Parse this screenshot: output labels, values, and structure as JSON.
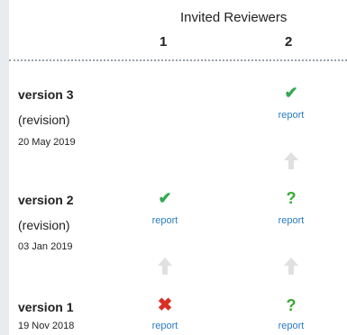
{
  "header": {
    "title": "Invited Reviewers",
    "columns": [
      "1",
      "2"
    ]
  },
  "versions": [
    {
      "title": "version 3",
      "subtitle": "(revision)",
      "date": "20 May 2019",
      "reviews": [
        null,
        {
          "status": "check",
          "icon": "check-icon",
          "link": "report"
        }
      ]
    },
    {
      "title": "version 2",
      "subtitle": "(revision)",
      "date": "03 Jan 2019",
      "reviews": [
        {
          "status": "check",
          "icon": "check-icon",
          "link": "report"
        },
        {
          "status": "question",
          "icon": "question-icon",
          "link": "report"
        }
      ]
    },
    {
      "title": "version 1",
      "subtitle": "",
      "date": "19 Nov 2018",
      "reviews": [
        {
          "status": "cross",
          "icon": "cross-icon",
          "link": "report"
        },
        {
          "status": "question",
          "icon": "question-icon",
          "link": "report"
        }
      ]
    }
  ],
  "colors": {
    "check": "#34a853",
    "question": "#3aaa35",
    "cross": "#d93025",
    "link": "#2a7bbf",
    "arrow": "#e0e0e0"
  },
  "glyphs": {
    "check": "✔",
    "question": "?",
    "cross": "✖"
  }
}
